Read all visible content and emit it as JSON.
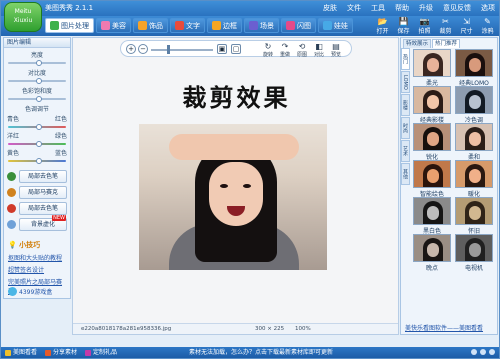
{
  "app": {
    "title": "美图秀秀 2.1.1",
    "logo_text": "Meitu Xiuxiu"
  },
  "menu": [
    "皮肤",
    "文件",
    "工具",
    "帮助",
    "升级",
    "意见反馈",
    "选项"
  ],
  "tabs": [
    {
      "label": "图片处理",
      "color": "#3fb24a",
      "active": true
    },
    {
      "label": "美容",
      "color": "#f07ab0",
      "active": false
    },
    {
      "label": "饰品",
      "color": "#f4a32a",
      "active": false
    },
    {
      "label": "文字",
      "color": "#e94b3c",
      "active": false
    },
    {
      "label": "边框",
      "color": "#f5a623",
      "active": false
    },
    {
      "label": "场景",
      "color": "#6b5fd0",
      "active": false
    },
    {
      "label": "闪图",
      "color": "#e64a8a",
      "active": false
    },
    {
      "label": "娃娃",
      "color": "#47a9e6",
      "active": false
    }
  ],
  "right_tools": [
    {
      "label": "打开",
      "icon": "open-icon",
      "glyph": "📂"
    },
    {
      "label": "保存",
      "icon": "save-icon",
      "glyph": "💾"
    },
    {
      "label": "拍照",
      "icon": "camera-icon",
      "glyph": "📷"
    },
    {
      "label": "裁剪",
      "icon": "crop-icon",
      "glyph": "✂"
    },
    {
      "label": "尺寸",
      "icon": "resize-icon",
      "glyph": "⇲"
    },
    {
      "label": "涂鸦",
      "icon": "brush-icon",
      "glyph": "✎"
    }
  ],
  "left": {
    "header": "图片编辑",
    "brightness": "亮度",
    "contrast": "对比度",
    "saturation": "色彩饱和度",
    "color_adjust": "色调调节",
    "c1": [
      "青色",
      "红色"
    ],
    "c2": [
      "洋红",
      "绿色"
    ],
    "c3": [
      "黄色",
      "蓝色"
    ],
    "buttons": [
      {
        "label": "局部去色笔",
        "icon": "brush-green-icon",
        "color": "#3a8f3a"
      },
      {
        "label": "局部马赛克",
        "icon": "mosaic-icon",
        "color": "#d0821e"
      },
      {
        "label": "局部去色笔",
        "icon": "color-pen-icon",
        "color": "#d03a2a"
      },
      {
        "label": "背景虚化",
        "icon": "blur-icon",
        "color": "#6fa1d8",
        "badge": "NEW"
      }
    ],
    "tips_title": "小技巧",
    "tips": [
      "抠图和大头贴的教程",
      "超赞签名设计",
      "完美照片之局部马赛克"
    ],
    "game": "4399游戏盒"
  },
  "center": {
    "tools": [
      "旋转",
      "重做",
      "原图",
      "对比",
      "预览"
    ],
    "heading": "裁剪效果",
    "status_file": "e220a8018178a281e958336.jpg",
    "status_dim": "300 × 225",
    "status_zoom": "100%"
  },
  "right": {
    "tabs": [
      "特效展示",
      "热门推荐"
    ],
    "vtabs": [
      "热门",
      "LOMO",
      "影楼",
      "时尚",
      "艺术",
      "其他"
    ],
    "effects": [
      {
        "label": "柔光",
        "h": "#3a2620",
        "f": "#e8b39a",
        "bg": "#e9d6c7"
      },
      {
        "label": "经典LOMO",
        "h": "#1a0f0d",
        "f": "#d89a7c",
        "bg": "#7a5a44"
      },
      {
        "label": "经典影楼",
        "h": "#2a1b16",
        "f": "#f2c5a8",
        "bg": "#d8b8a0"
      },
      {
        "label": "冷色调",
        "h": "#121a24",
        "f": "#b8c2d0",
        "bg": "#8d9cb0"
      },
      {
        "label": "锐化",
        "h": "#160f0c",
        "f": "#e0a584",
        "bg": "#b89078"
      },
      {
        "label": "柔和",
        "h": "#2b1e18",
        "f": "#eebfa4",
        "bg": "#d7c1b2"
      },
      {
        "label": "智能绘色",
        "h": "#2a140c",
        "f": "#e9a06e",
        "bg": "#c0784a"
      },
      {
        "label": "暖化",
        "h": "#2a1810",
        "f": "#f0b089",
        "bg": "#d69a6a"
      },
      {
        "label": "黑白色",
        "h": "#151515",
        "f": "#bdbdbd",
        "bg": "#8a8a8a"
      },
      {
        "label": "怀旧",
        "h": "#302418",
        "f": "#d2b890",
        "bg": "#b49c74"
      },
      {
        "label": "晚点",
        "h": "#1a1614",
        "f": "#c8b8ac",
        "bg": "#9a8e84"
      },
      {
        "label": "电视机",
        "h": "#202020",
        "f": "#9a9a9a",
        "bg": "#5e5e5e"
      }
    ],
    "footer": "美快乐看图软件——美图看看"
  },
  "bottom": {
    "left": [
      "美图看看",
      "分享素材",
      "定制礼品"
    ],
    "message": "素材无法加载，怎么办？点击下载最新素材库即可更新",
    "colors": [
      "#f0c02a",
      "#e65a2a",
      "#c43aa8"
    ]
  }
}
